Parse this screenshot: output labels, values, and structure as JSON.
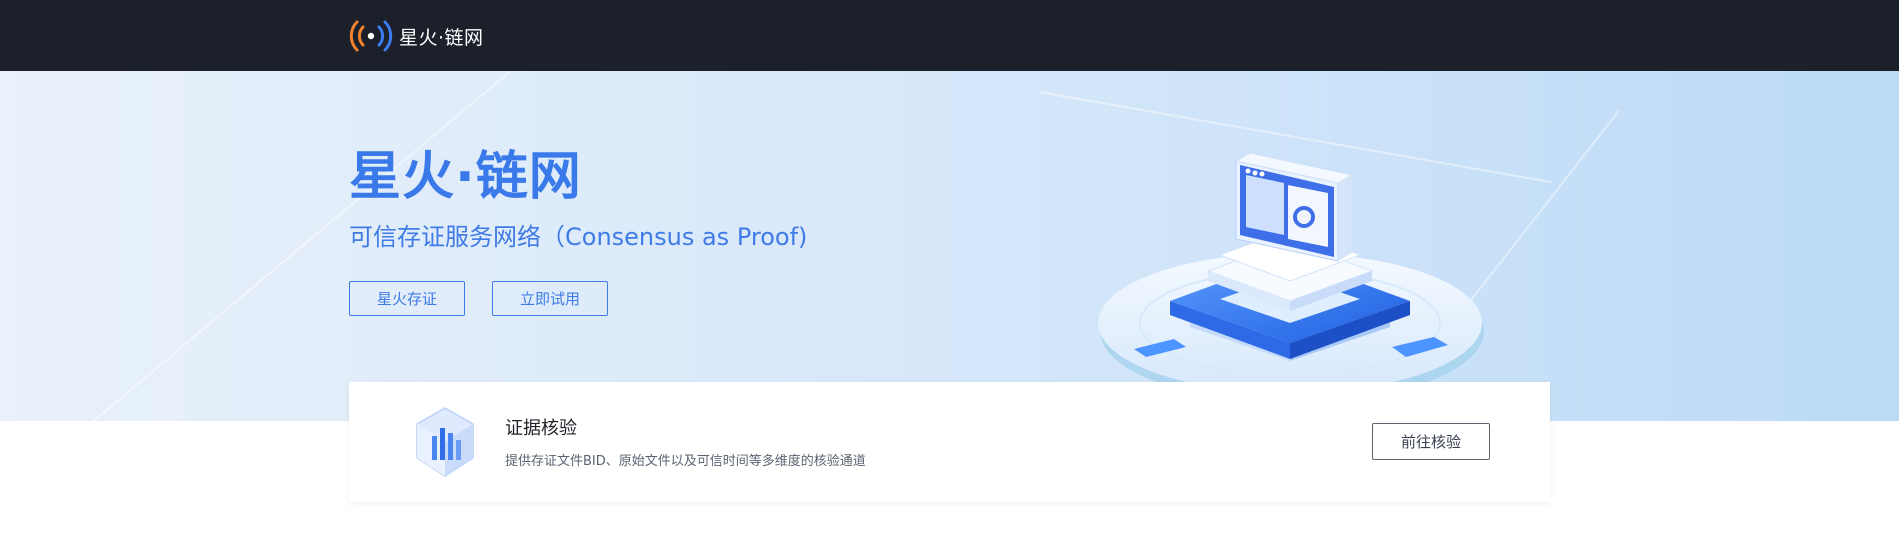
{
  "header": {
    "brand": "星火·链网",
    "logo_icon": "radio-signal-icon",
    "background": "#1c202b"
  },
  "hero": {
    "title": "星火·链网",
    "subtitle": "可信存证服务网络（Consensus as Proof)",
    "buttons": [
      "星火存证",
      "立即试用"
    ],
    "accent": "#3a79ea"
  },
  "verify_card": {
    "icon": "data-cube-icon",
    "title": "证据核验",
    "description": "提供存证文件BID、原始文件以及可信时间等多维度的核验通道",
    "button": "前往核验"
  }
}
